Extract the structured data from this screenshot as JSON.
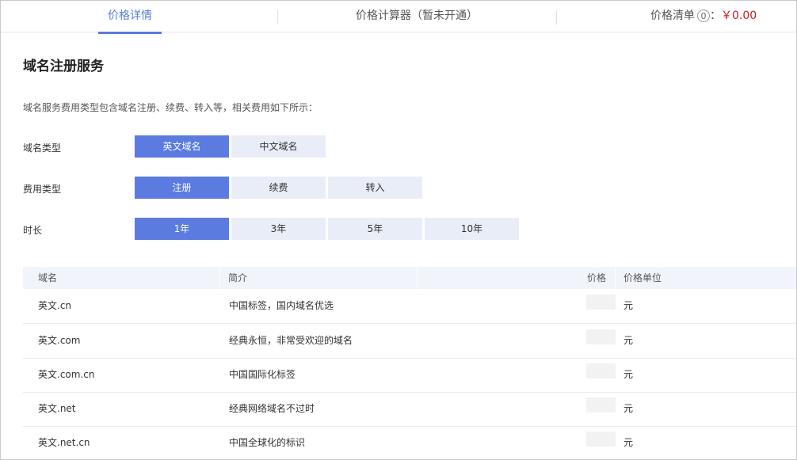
{
  "tabs": [
    {
      "label": "价格详情"
    },
    {
      "label": "价格计算器（暂未开通）"
    },
    {
      "label": "价格清单"
    }
  ],
  "cart": {
    "count": "0",
    "price": "￥0.00",
    "separator": "："
  },
  "title": "域名注册服务",
  "description": "域名服务费用类型包含域名注册、续费、转入等，相关费用如下所示：",
  "options": {
    "domain_type": {
      "label": "域名类型",
      "choices": [
        "英文域名",
        "中文域名"
      ],
      "selected": "英文域名"
    },
    "fee_type": {
      "label": "费用类型",
      "choices": [
        "注册",
        "续费",
        "转入"
      ],
      "selected": "注册"
    },
    "duration": {
      "label": "时长",
      "choices": [
        "1年",
        "3年",
        "5年",
        "10年"
      ],
      "selected": "1年"
    }
  },
  "table": {
    "headers": [
      "域名",
      "简介",
      "价格",
      "价格单位"
    ],
    "rows": [
      {
        "domain": "英文.cn",
        "intro": "中国标签，国内域名优选",
        "unit": "元"
      },
      {
        "domain": "英文.com",
        "intro": "经典永恒，非常受欢迎的域名",
        "unit": "元"
      },
      {
        "domain": "英文.com.cn",
        "intro": "中国国际化标签",
        "unit": "元"
      },
      {
        "domain": "英文.net",
        "intro": "经典网络域名不过时",
        "unit": "元"
      },
      {
        "domain": "英文.net.cn",
        "intro": "中国全球化的标识",
        "unit": "元"
      }
    ]
  },
  "colors": {
    "accent": "#5b7be0",
    "price": "#c0201e",
    "header_bg": "#f1f4fb",
    "option_bg": "#e9edf7"
  }
}
